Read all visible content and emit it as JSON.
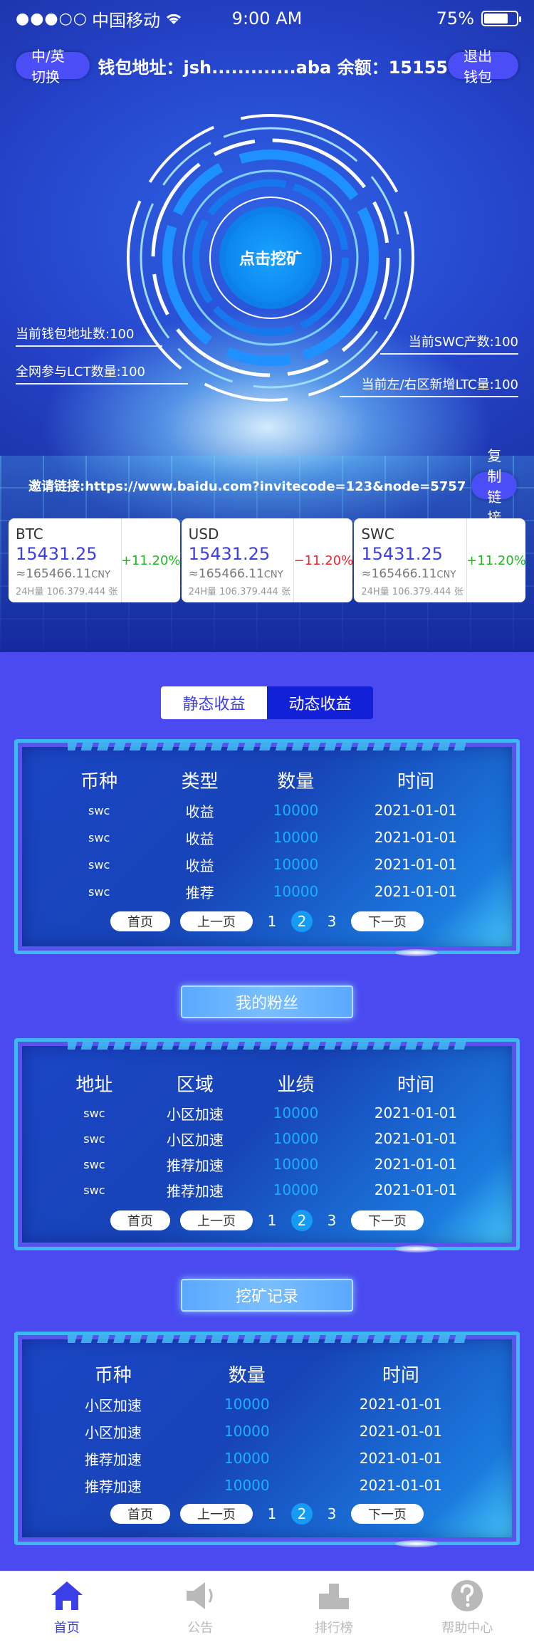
{
  "status": {
    "signal": "●●●○○",
    "carrier": "中国移动",
    "time": "9:00 AM",
    "battery": "75%",
    "battery_level": 0.75
  },
  "header": {
    "lang_toggle": "中/英切换",
    "wallet_info": "钱包地址：jsh.............aba 余额：15155",
    "logout": "退出钱包"
  },
  "hero": {
    "mine_button": "点击挖矿",
    "stats": {
      "wallet_count": "当前钱包地址数:100",
      "lct_participants": "全网参与LCT数量:100",
      "swc_output": "当前SWC产数:100",
      "ltc_new": "当前左/右区新增LTC量:100"
    },
    "invite_text": "邀请链接:https://www.baidu.com?invitecode=123&node=5757",
    "copy_button": "复制链接"
  },
  "tickers": [
    {
      "symbol": "BTC",
      "price": "15431.25",
      "cny": "≈165466.11",
      "cny_unit": "CNY",
      "volume": "24H量 106.379.444 张",
      "change": "+11.20%",
      "direction": "up"
    },
    {
      "symbol": "USD",
      "price": "15431.25",
      "cny": "≈165466.11",
      "cny_unit": "CNY",
      "volume": "24H量 106.379.444 张",
      "change": "−11.20%",
      "direction": "down"
    },
    {
      "symbol": "SWC",
      "price": "15431.25",
      "cny": "≈165466.11",
      "cny_unit": "CNY",
      "volume": "24H量 106.379.444 张",
      "change": "+11.20%",
      "direction": "up"
    }
  ],
  "tabs": [
    "静态收益",
    "动态收益"
  ],
  "active_tab": 1,
  "earnings_table": {
    "headers": [
      "币种",
      "类型",
      "数量",
      "时间"
    ],
    "rows": [
      [
        "swc",
        "收益",
        "10000",
        "2021-01-01"
      ],
      [
        "swc",
        "收益",
        "10000",
        "2021-01-01"
      ],
      [
        "swc",
        "收益",
        "10000",
        "2021-01-01"
      ],
      [
        "swc",
        "推荐",
        "10000",
        "2021-01-01"
      ]
    ]
  },
  "fans": {
    "title": "我的粉丝",
    "headers": [
      "地址",
      "区域",
      "业绩",
      "时间"
    ],
    "rows": [
      [
        "swc",
        "小区加速",
        "10000",
        "2021-01-01"
      ],
      [
        "swc",
        "小区加速",
        "10000",
        "2021-01-01"
      ],
      [
        "swc",
        "推荐加速",
        "10000",
        "2021-01-01"
      ],
      [
        "swc",
        "推荐加速",
        "10000",
        "2021-01-01"
      ]
    ]
  },
  "mining": {
    "title": "挖矿记录",
    "headers": [
      "币种",
      "数量",
      "时间"
    ],
    "rows": [
      [
        "小区加速",
        "10000",
        "2021-01-01"
      ],
      [
        "小区加速",
        "10000",
        "2021-01-01"
      ],
      [
        "推荐加速",
        "10000",
        "2021-01-01"
      ],
      [
        "推荐加速",
        "10000",
        "2021-01-01"
      ]
    ]
  },
  "pager": {
    "first": "首页",
    "prev": "上一页",
    "pages": [
      "1",
      "2",
      "3"
    ],
    "current": "2",
    "next": "下一页"
  },
  "nav": [
    {
      "label": "首页",
      "icon": "home-icon",
      "active": true
    },
    {
      "label": "公告",
      "icon": "megaphone-icon",
      "active": false
    },
    {
      "label": "排行榜",
      "icon": "podium-icon",
      "active": false
    },
    {
      "label": "帮助中心",
      "icon": "help-icon",
      "active": false
    }
  ],
  "colors": {
    "accent": "#3b3fe8",
    "up": "#21b821",
    "down": "#e8262c",
    "cyan": "#19b0ff"
  }
}
